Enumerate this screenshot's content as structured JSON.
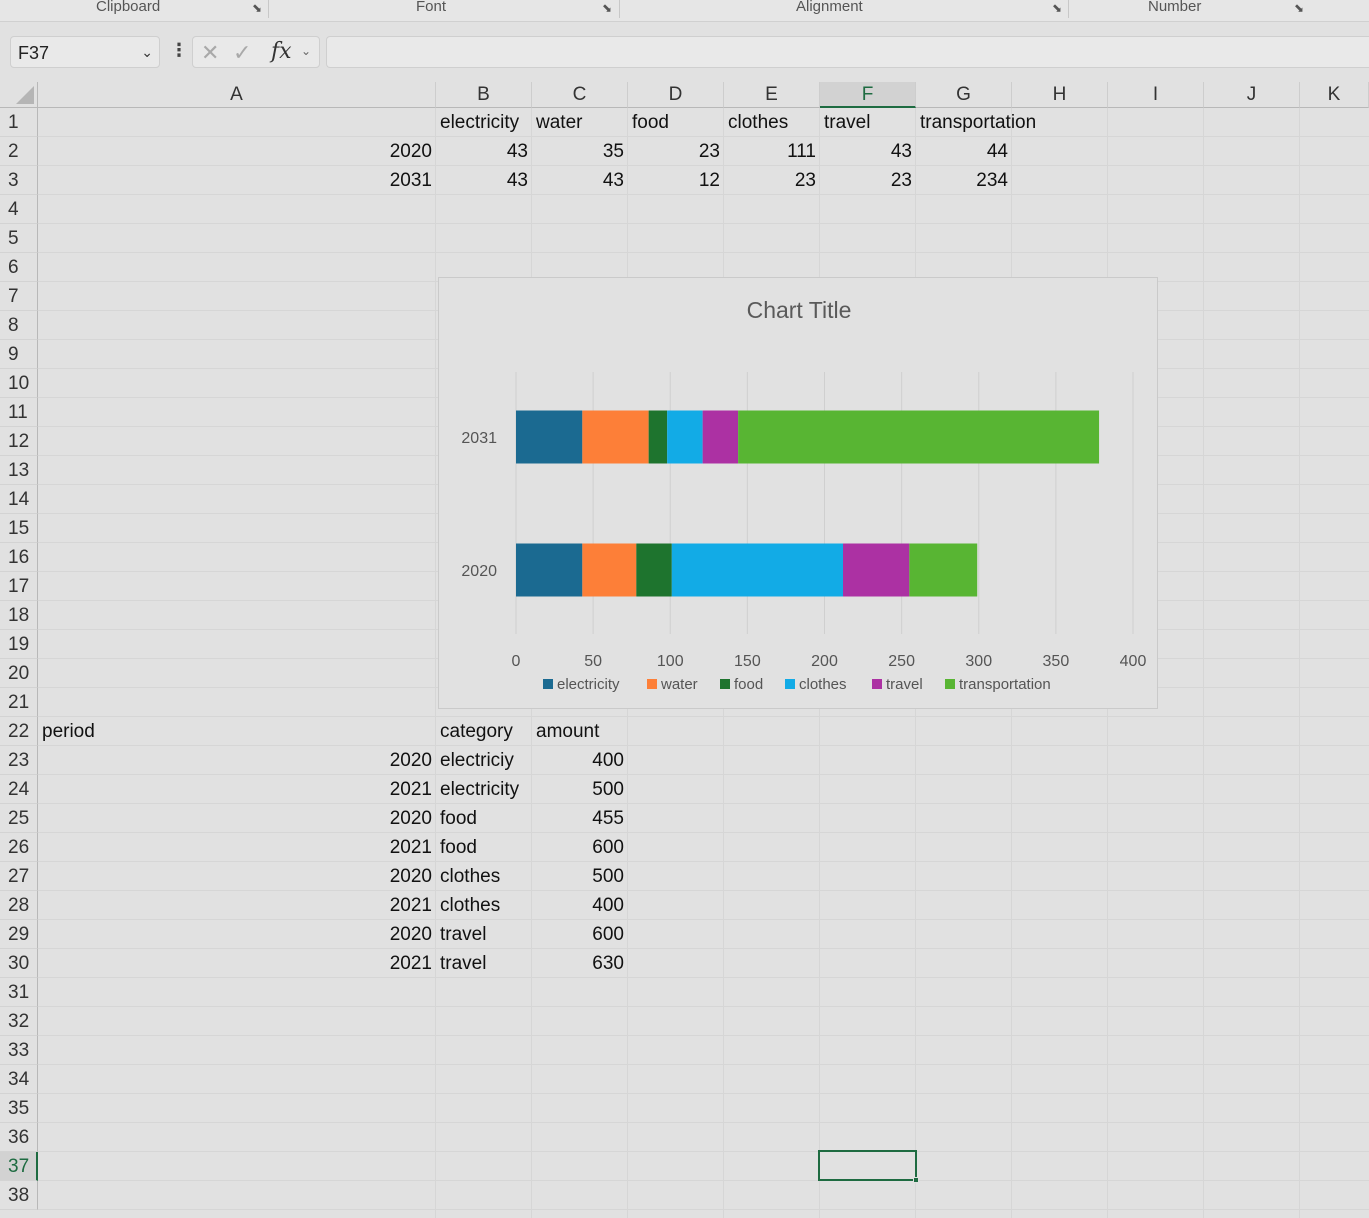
{
  "ribbon": {
    "groups": [
      {
        "label": "Clipboard"
      },
      {
        "label": "Font"
      },
      {
        "label": "Alignment"
      },
      {
        "label": "Number"
      }
    ]
  },
  "formula_bar": {
    "name_box": "F37",
    "formula": ""
  },
  "columns": [
    "A",
    "B",
    "C",
    "D",
    "E",
    "F",
    "G",
    "H",
    "I",
    "J",
    "K"
  ],
  "active_column": "F",
  "rows": [
    "1",
    "2",
    "3",
    "4",
    "5",
    "6",
    "7",
    "8",
    "9",
    "10",
    "11",
    "12",
    "13",
    "14",
    "15",
    "16",
    "17",
    "18",
    "19",
    "20",
    "21",
    "22",
    "23",
    "24",
    "25",
    "26",
    "27",
    "28",
    "29",
    "30",
    "31",
    "32",
    "33",
    "34",
    "35",
    "36",
    "37",
    "38"
  ],
  "active_row": "37",
  "table1": {
    "headers": [
      "electricity",
      "water",
      "food",
      "clothes",
      "travel",
      "transportation"
    ],
    "rows": [
      {
        "period": "2020",
        "values": [
          "43",
          "35",
          "23",
          "111",
          "43",
          "44"
        ]
      },
      {
        "period": "2031",
        "values": [
          "43",
          "43",
          "12",
          "23",
          "23",
          "234"
        ]
      }
    ]
  },
  "table2": {
    "headers": [
      "period",
      "category",
      "amount"
    ],
    "rows": [
      {
        "period": "2020",
        "category": "electriciy",
        "amount": "400"
      },
      {
        "period": "2021",
        "category": "electricity",
        "amount": "500"
      },
      {
        "period": "2020",
        "category": "food",
        "amount": "455"
      },
      {
        "period": "2021",
        "category": "food",
        "amount": "600"
      },
      {
        "period": "2020",
        "category": "clothes",
        "amount": "500"
      },
      {
        "period": "2021",
        "category": "clothes",
        "amount": "400"
      },
      {
        "period": "2020",
        "category": "travel",
        "amount": "600"
      },
      {
        "period": "2021",
        "category": "travel",
        "amount": "630"
      }
    ]
  },
  "chart_data": {
    "type": "bar",
    "orientation": "horizontal",
    "stacked": true,
    "title": "Chart Title",
    "categories": [
      "2020",
      "2031"
    ],
    "series": [
      {
        "name": "electricity",
        "values": [
          43,
          43
        ],
        "color": "#1b6a91"
      },
      {
        "name": "water",
        "values": [
          35,
          43
        ],
        "color": "#fd7f38"
      },
      {
        "name": "food",
        "values": [
          23,
          12
        ],
        "color": "#1e742e"
      },
      {
        "name": "clothes",
        "values": [
          111,
          23
        ],
        "color": "#12abe6"
      },
      {
        "name": "travel",
        "values": [
          43,
          23
        ],
        "color": "#ac31a3"
      },
      {
        "name": "transportation",
        "values": [
          44,
          234
        ],
        "color": "#58b533"
      }
    ],
    "xlim": [
      0,
      400
    ],
    "xticks": [
      "0",
      "50",
      "100",
      "150",
      "200",
      "250",
      "300",
      "350",
      "400"
    ],
    "grid": true,
    "legend": "bottom"
  },
  "colors": {
    "accent": "#1e6b41"
  }
}
